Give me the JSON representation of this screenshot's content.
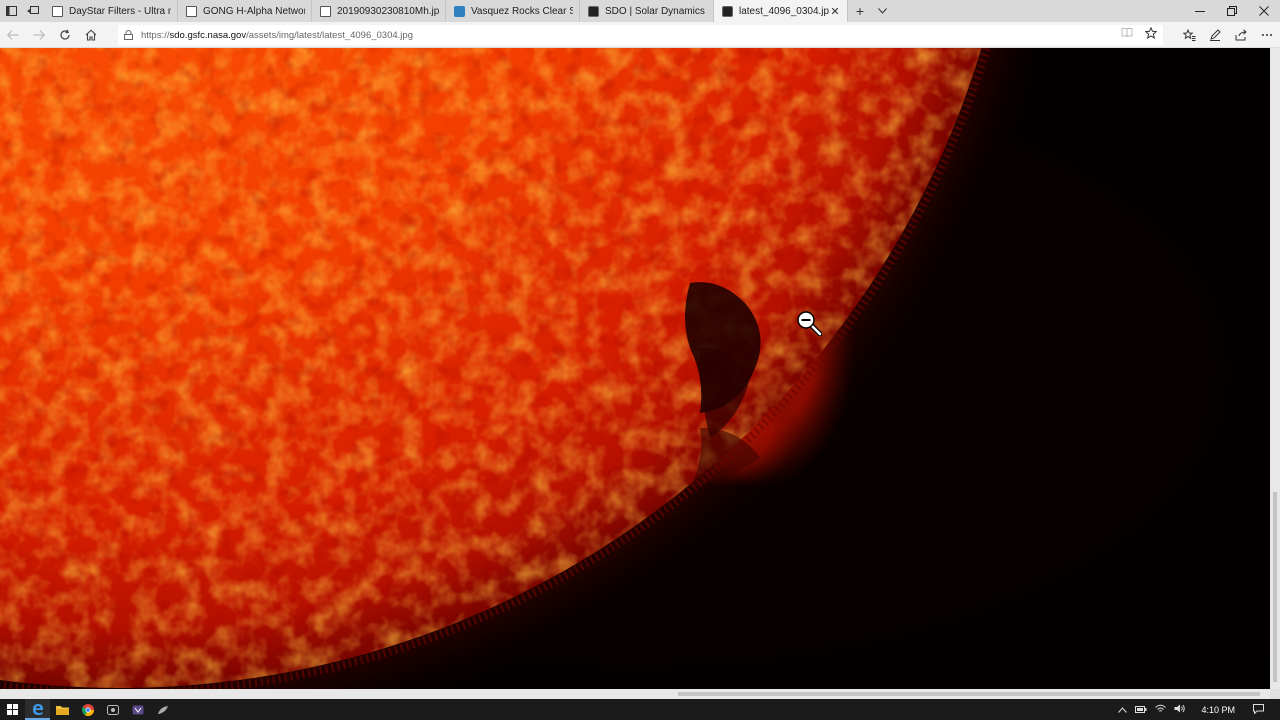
{
  "tabs": [
    {
      "title": "DayStar Filters - Ultra narro",
      "icon": "page-icon"
    },
    {
      "title": "GONG H-Alpha Network M",
      "icon": "page-icon"
    },
    {
      "title": "20190930230810Mh.jpg",
      "icon": "page-icon"
    },
    {
      "title": "Vasquez Rocks Clear Sky Ch",
      "icon": "globe-icon"
    },
    {
      "title": "SDO | Solar Dynamics Obse",
      "icon": "sdo-icon"
    },
    {
      "title": "latest_4096_0304.jpg",
      "icon": "sdo-icon"
    }
  ],
  "address": {
    "scheme": "https://",
    "host": "sdo.gsfc.nasa.gov",
    "path": "/assets/img/latest/latest_4096_0304.jpg"
  },
  "image": {
    "subject": "zoom-out-cursor-icon"
  },
  "taskbar": {
    "time": "4:10 PM"
  },
  "colors": {
    "sun_core": "#ff4a00",
    "sun_mid": "#d91800",
    "sun_edge": "#8a0800",
    "space": "#050000"
  }
}
